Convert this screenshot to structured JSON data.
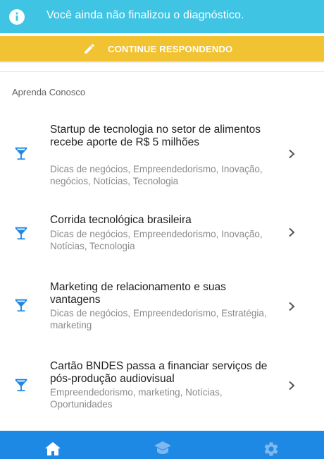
{
  "banner": {
    "icon": "info-icon",
    "text": "Você ainda não finalizou o diagnóstico."
  },
  "continue_button": {
    "icon": "pencil-icon",
    "label": "CONTINUE RESPONDENDO"
  },
  "section": {
    "title": "Aprenda Conosco"
  },
  "list": {
    "items": [
      {
        "icon": "cocktail-glass-icon",
        "title": "Startup de tecnologia no setor de alimentos recebe aporte de R$ 5 milhões",
        "tags": "Dicas de negócios, Empreendedorismo, Inovação, negócios, Notícias, Tecnologia"
      },
      {
        "icon": "cocktail-glass-icon",
        "title": "Corrida tecnológica brasileira",
        "tags": "Dicas de negócios, Empreendedorismo, Inovação, Notícias, Tecnologia"
      },
      {
        "icon": "cocktail-glass-icon",
        "title": "Marketing de relacionamento e suas vantagens",
        "tags": "Dicas de negócios, Empreendedorismo, Estratégia, marketing"
      },
      {
        "icon": "cocktail-glass-icon",
        "title": "Cartão BNDES passa a financiar serviços de pós-produção audiovisual",
        "tags": "Empreendedorismo, marketing, Notícias, Oportunidades"
      }
    ]
  },
  "bottom_nav": {
    "items": [
      "home-icon",
      "graduation-cap-icon",
      "gear-icon"
    ]
  },
  "colors": {
    "banner": "#3fc4e4",
    "button": "#f1c232",
    "accent": "#1e88e5"
  }
}
